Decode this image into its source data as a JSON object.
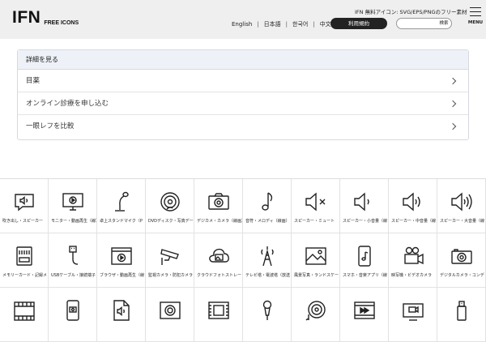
{
  "header": {
    "logo": "IFN",
    "logo_sub": "FREE ICONS",
    "tagline": "IFN 無料アイコン: SVG/EPS/PNGのフリー素材",
    "languages": [
      "English",
      "日本語",
      "한국어",
      "中文"
    ],
    "terms_button": "利用規約",
    "search_placeholder": "",
    "search_button": "検索",
    "menu_label": "MENU"
  },
  "details": {
    "heading": "詳細を見る",
    "items": [
      "目薬",
      "オンライン診療を申し込む",
      "一眼レフを比較"
    ]
  },
  "icons": {
    "row1": [
      {
        "icon": "speech-bubble-speaker-icon",
        "caption": "吹き出し・スピーカー"
      },
      {
        "icon": "monitor-play-icon",
        "caption": "モニター・動画再生（線）"
      },
      {
        "icon": "desk-microphone-icon",
        "caption": "卓上スタンドマイク（P"
      },
      {
        "icon": "dvd-disc-icon",
        "caption": "DVDディスク・写真データ"
      },
      {
        "icon": "digital-camera-icon",
        "caption": "デジカメ・カメラ（線画）"
      },
      {
        "icon": "music-note-icon",
        "caption": "音符・メロディ（線画）"
      },
      {
        "icon": "speaker-mute-icon",
        "caption": "スピーカー・ミュート"
      },
      {
        "icon": "speaker-low-icon",
        "caption": "スピーカー・小音量（線"
      },
      {
        "icon": "speaker-medium-icon",
        "caption": "スピーカー・中音量（線"
      },
      {
        "icon": "speaker-high-icon",
        "caption": "スピーカー・大音量（線"
      }
    ],
    "row2": [
      {
        "icon": "memory-card-icon",
        "caption": "メモリーカード・記録メ"
      },
      {
        "icon": "usb-cable-icon",
        "caption": "USBケーブル・接続端子"
      },
      {
        "icon": "browser-video-icon",
        "caption": "ブラウザ・動画再生（線"
      },
      {
        "icon": "security-camera-icon",
        "caption": "監視カメラ・防犯カメラ"
      },
      {
        "icon": "cloud-photo-icon",
        "caption": "クラウドフォトストレー"
      },
      {
        "icon": "tv-tower-icon",
        "caption": "テレビ塔・電波塔（放送"
      },
      {
        "icon": "landscape-photo-icon",
        "caption": "風景写真・ランドスケー"
      },
      {
        "icon": "smartphone-music-icon",
        "caption": "スマホ・音楽アプリ（線"
      },
      {
        "icon": "video-camera-icon",
        "caption": "映写機・ビデオカメラ"
      },
      {
        "icon": "digital-camera-compact-icon",
        "caption": "デジタルカメラ・コンデ"
      }
    ],
    "row3": [
      {
        "icon": "film-icon",
        "caption": ""
      },
      {
        "icon": "smartphone-camera-icon",
        "caption": ""
      },
      {
        "icon": "audio-file-icon",
        "caption": ""
      },
      {
        "icon": "screen-record-icon",
        "caption": ""
      },
      {
        "icon": "film-frame-icon",
        "caption": ""
      },
      {
        "icon": "microphone-icon",
        "caption": ""
      },
      {
        "icon": "vinyl-music-icon",
        "caption": ""
      },
      {
        "icon": "fast-forward-video-icon",
        "caption": ""
      },
      {
        "icon": "tv-channel-icon",
        "caption": ""
      },
      {
        "icon": "usb-stick-icon",
        "caption": ""
      }
    ]
  }
}
